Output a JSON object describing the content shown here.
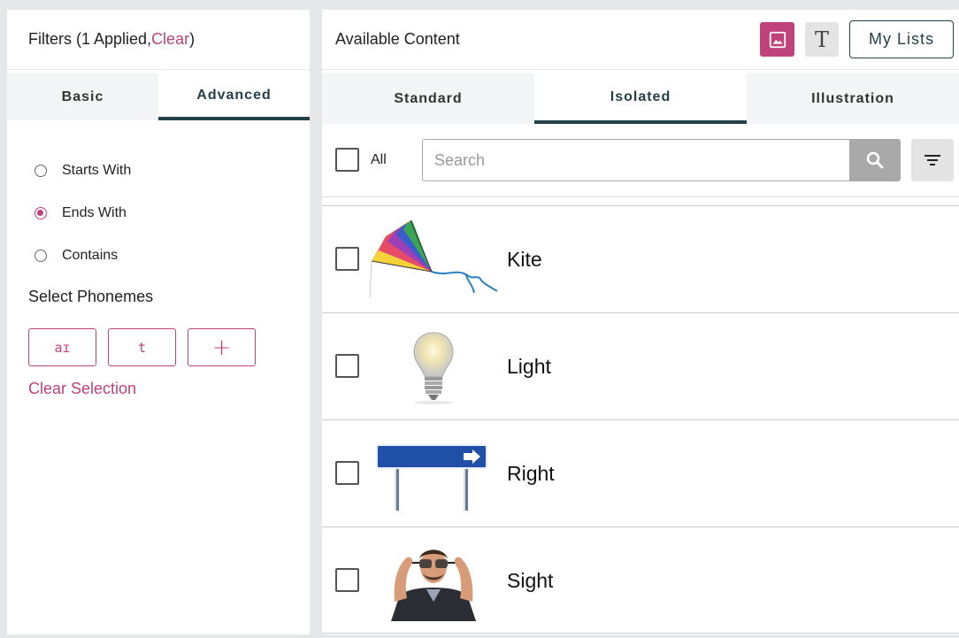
{
  "filters": {
    "title_prefix": "Filters (1 Applied, ",
    "clear_label": "Clear",
    "title_suffix": ")",
    "tabs": [
      {
        "label": "Basic",
        "active": false
      },
      {
        "label": "Advanced",
        "active": true
      }
    ],
    "match_options": [
      {
        "label": "Starts With",
        "selected": false
      },
      {
        "label": "Ends With",
        "selected": true
      },
      {
        "label": "Contains",
        "selected": false
      }
    ],
    "phonemes_heading": "Select Phonemes",
    "phonemes": [
      "aɪ",
      "t"
    ],
    "add_phoneme_label": "+",
    "clear_selection_label": "Clear Selection"
  },
  "content": {
    "title": "Available Content",
    "image_view_icon": "image-icon",
    "text_view_icon": "text-format-icon",
    "text_view_glyph": "T",
    "my_lists_label": "My Lists",
    "tabs": [
      {
        "label": "Standard",
        "active": false
      },
      {
        "label": "Isolated",
        "active": true
      },
      {
        "label": "Illustration",
        "active": false
      }
    ],
    "select_all_label": "All",
    "search_placeholder": "Search",
    "search_value": "",
    "items": [
      {
        "label": "Kite",
        "icon": "kite-image"
      },
      {
        "label": "Light",
        "icon": "light-bulb-image"
      },
      {
        "label": "Right",
        "icon": "right-arrow-sign-image"
      },
      {
        "label": "Sight",
        "icon": "man-with-glasses-image"
      }
    ]
  },
  "colors": {
    "accent": "#c0427a",
    "primary": "#22414a",
    "background": "#e6e7e9"
  }
}
